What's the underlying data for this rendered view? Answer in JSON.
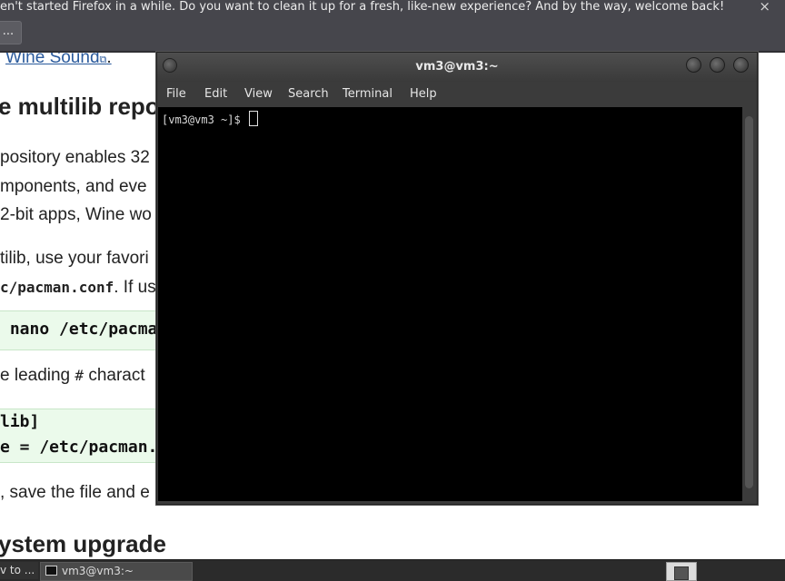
{
  "notification": {
    "text": "en't started Firefox in a while. Do you want to clean it up for a fresh, like-new experience? And by the way, welcome back!",
    "button_label": "...",
    "close_glyph": "×"
  },
  "article": {
    "wine_link": "Wine Sound",
    "wine_link_suffix": ".",
    "heading_multilib": "e multilib repo",
    "para_lines": [
      "pository enables 32",
      "mponents, and eve",
      "2-bit apps, Wine wo",
      "tilib, use your favori"
    ],
    "conf_path": "c/pacman.conf",
    "conf_after": ". If us",
    "code_nano": " nano /etc/pacma",
    "leading_text_before": "e leading ",
    "leading_hash": "#",
    "leading_text_after": " charact",
    "code_lines": [
      "lib]",
      "e = /etc/pacman."
    ],
    "save_line": ", save the file and e",
    "heading_upgrade": "ystem upgrade"
  },
  "terminal": {
    "title": "vm3@vm3:~",
    "menu": [
      "File",
      "Edit",
      "View",
      "Search",
      "Terminal",
      "Help"
    ],
    "prompt": "[vm3@vm3 ~]$ "
  },
  "taskbar": {
    "task1": "v to ...",
    "task2": "vm3@vm3:~"
  },
  "colors": {
    "notification_bg": "#46464c",
    "terminal_bg": "#000000",
    "code_bg": "#ebfaeb",
    "link": "#2a5a9c"
  }
}
